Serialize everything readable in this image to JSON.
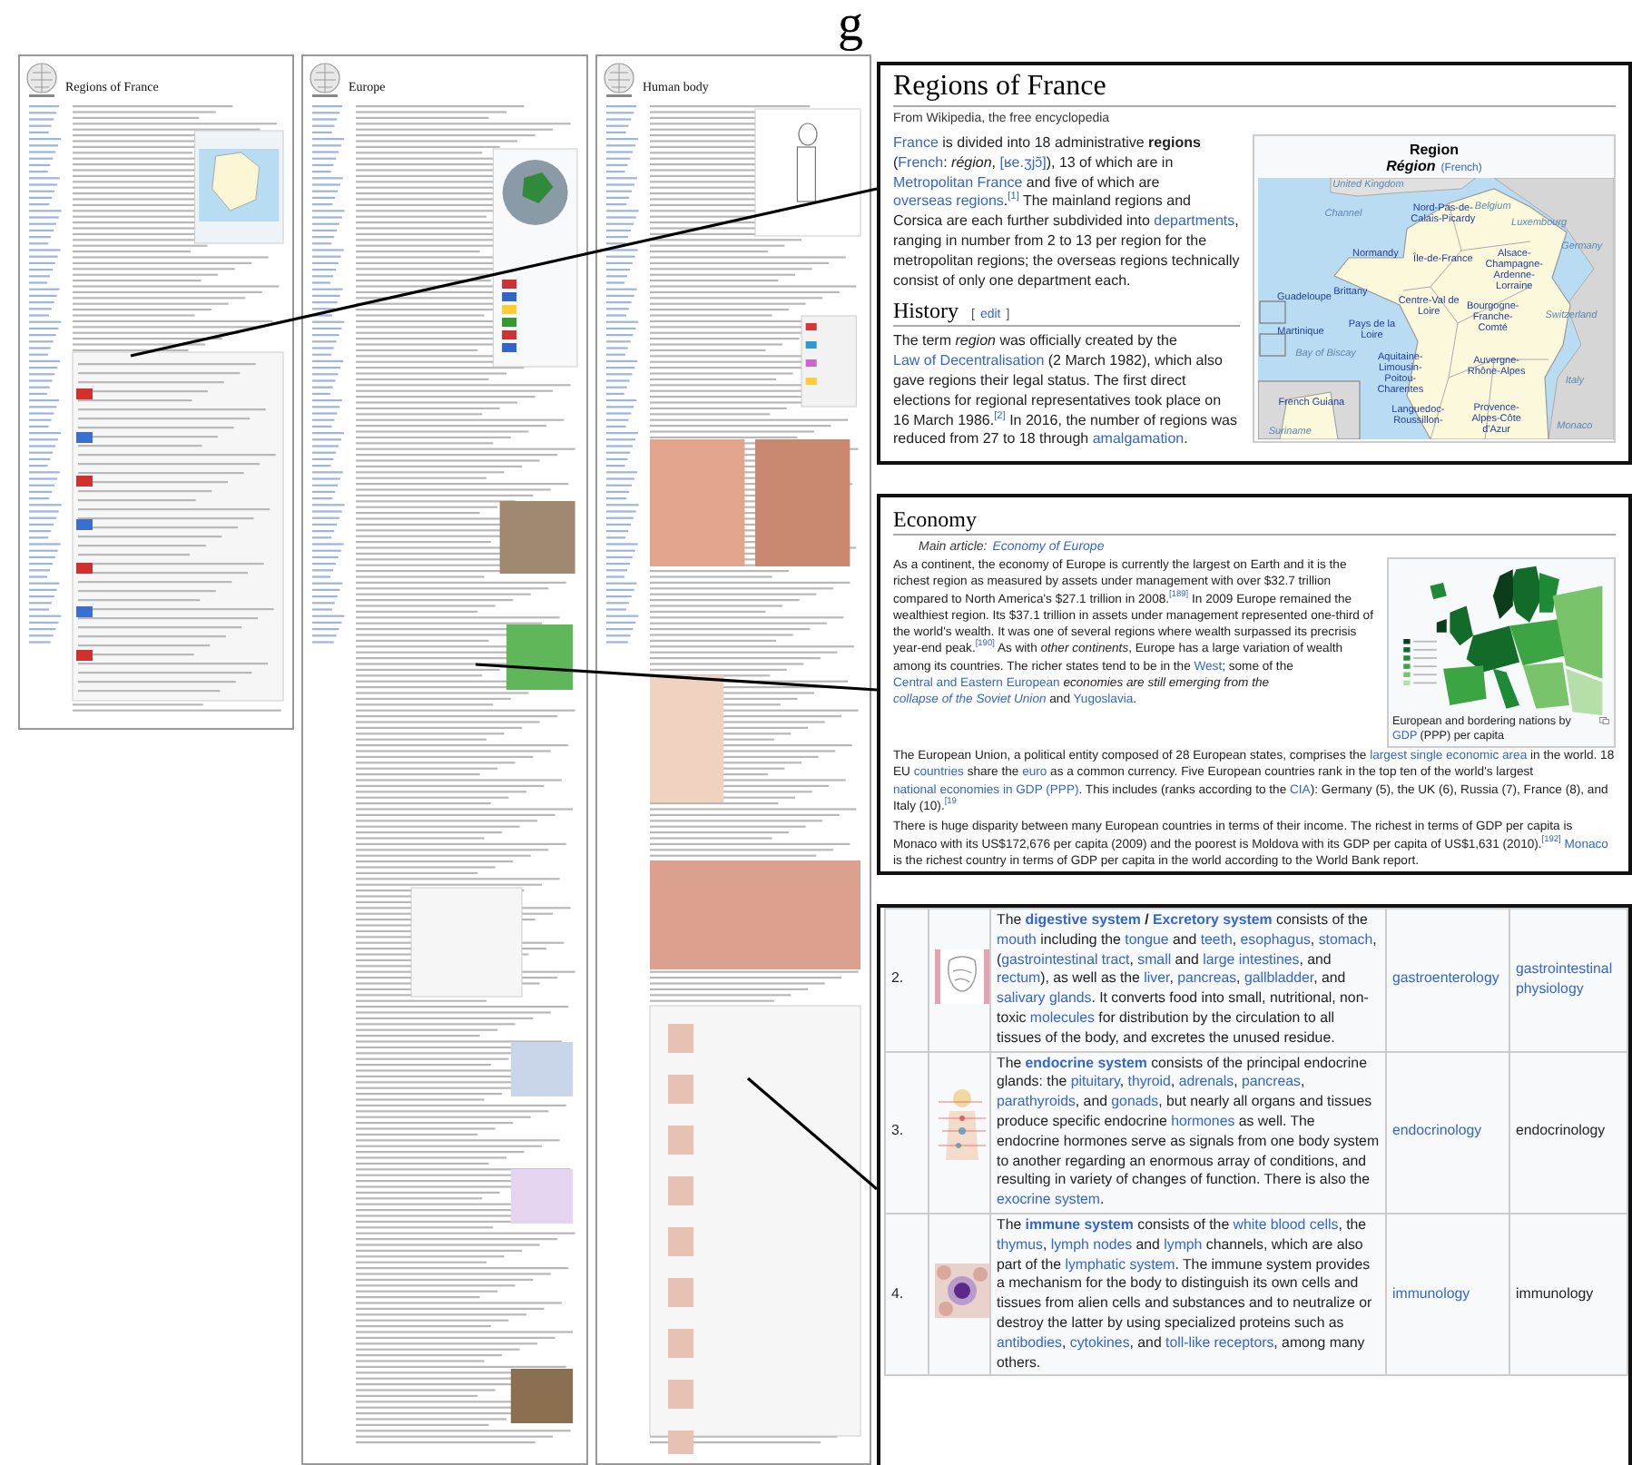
{
  "figure_label": "g",
  "thumbnails": [
    {
      "title": "Regions of France",
      "kind": "france"
    },
    {
      "title": "Europe",
      "kind": "europe"
    },
    {
      "title": "Human body",
      "kind": "body"
    }
  ],
  "france": {
    "title": "Regions of France",
    "tagline": "From Wikipedia, the free encyclopedia",
    "intro": [
      {
        "link": "France"
      },
      " is divided into 18 administrative **regions** (",
      {
        "link": "French"
      },
      ": *région*, ",
      {
        "link": "[ʁe.ʒjɔ̃]"
      },
      "), 13 of which are in ",
      {
        "link": "Metropolitan France"
      },
      " and five of which are ",
      {
        "link": "overseas regions"
      },
      ".",
      {
        "ref": "[1]"
      },
      "The mainland regions and Corsica are each further subdivided into ",
      {
        "link": "departments"
      },
      ", ranging in number from 2 to 13 per region for the metropolitan regions; the overseas regions technically consist of only one department each."
    ],
    "history_heading": "History",
    "edit_brackets": [
      "[",
      "]"
    ],
    "edit_label": "edit",
    "history": [
      "The term *region* was officially created by the ",
      {
        "link": "Law of Decentralisation"
      },
      " (2 March 1982), which also gave regions their legal status. The first direct elections for regional representatives took place on 16 March 1986.",
      {
        "ref": "[2]"
      },
      "In 2016, the number of regions was reduced from 27 to 18 through ",
      {
        "link": "amalgamation"
      },
      "."
    ],
    "map": {
      "title": "Region",
      "subtitle": "Région",
      "language": "(French)",
      "labels": [
        {
          "text": "United Kingdom",
          "kind": "place"
        },
        {
          "text": "Belgium",
          "kind": "place"
        },
        {
          "text": "Channel",
          "kind": "place"
        },
        {
          "text": "Nord-Pas-de-Calais-Picardy",
          "kind": "region"
        },
        {
          "text": "Luxembourg",
          "kind": "place"
        },
        {
          "text": "Germany",
          "kind": "place"
        },
        {
          "text": "Normandy",
          "kind": "region"
        },
        {
          "text": "Île-de-France",
          "kind": "region"
        },
        {
          "text": "Alsace-Champagne-Ardenne-Lorraine",
          "kind": "region"
        },
        {
          "text": "Guadeloupe",
          "kind": "region"
        },
        {
          "text": "Brittany",
          "kind": "region"
        },
        {
          "text": "Centre-Val de Loire",
          "kind": "region"
        },
        {
          "text": "Bourgogne-Franche-Comté",
          "kind": "region"
        },
        {
          "text": "Switzerland",
          "kind": "place"
        },
        {
          "text": "Martinique",
          "kind": "region"
        },
        {
          "text": "Pays de la Loire",
          "kind": "region"
        },
        {
          "text": "Bay of Biscay",
          "kind": "place"
        },
        {
          "text": "Aquitaine-Limousin-Poitou-Charentes",
          "kind": "region"
        },
        {
          "text": "Auvergne-Rhône-Alpes",
          "kind": "region"
        },
        {
          "text": "Italy",
          "kind": "place"
        },
        {
          "text": "French Guiana",
          "kind": "region"
        },
        {
          "text": "Languedoc-Roussillon-",
          "kind": "region"
        },
        {
          "text": "Provence-Alpes-Côte d'Azur",
          "kind": "region"
        },
        {
          "text": "Monaco",
          "kind": "place"
        },
        {
          "text": "Suriname",
          "kind": "place"
        }
      ]
    }
  },
  "economy": {
    "heading": "Economy",
    "main_prefix": "Main article:",
    "main_link": "Economy of Europe",
    "paragraphs": [
      [
        "As a continent, the economy of Europe is currently the largest on Earth and it is the richest region as measured by assets under management with over $32.7 trillion compared to North America's $27.1 trillion in 2008.",
        {
          "ref": "[189]"
        },
        "In 2009 Europe remained the wealthiest region. Its $37.1 trillion in assets under management represented one-third of the world's wealth. It was one of several regions where wealth surpassed its precrisis year-end peak.",
        {
          "ref": "[190]"
        },
        "As with *other continents*, Europe has a large variation of wealth among its countries. The richer states tend to be in the ",
        {
          "link": "West"
        },
        "; some of the ",
        {
          "link": "Central and Eastern European"
        },
        " *economies are still emerging from the* ",
        {
          "link": "collapse of the Soviet Union",
          "italic": true
        },
        " and ",
        {
          "link": "Yugoslavia"
        },
        "."
      ],
      [
        "The European Union, a political entity composed of 28 European states, comprises the ",
        {
          "link": "largest single economic area"
        },
        " in the world. 18 EU ",
        {
          "link": "countries"
        },
        " share the ",
        {
          "link": "euro"
        },
        " as a common currency. Five European countries rank in the top ten of the world's largest ",
        {
          "link": "national economies in GDP (PPP)"
        },
        ". This includes (ranks according to the ",
        {
          "link": "CIA"
        },
        "): Germany (5), the UK (6), Russia (7), France (8), and Italy (10).",
        {
          "ref": "[19"
        }
      ],
      [
        "There is huge disparity between many European countries in terms of their income. The richest in terms of GDP per capita is Monaco with its US$172,676 per capita (2009) and the poorest is Moldova with its GDP per capita of US$1,631 (2010).",
        {
          "ref": "[192]"
        },
        {
          "link": "Monaco"
        },
        " is the richest country in terms of GDP per capita in the world according to the World Bank report."
      ]
    ],
    "caption": [
      "European and bordering nations by ",
      {
        "link": "GDP"
      },
      " (PPP) per capita"
    ]
  },
  "body_table": {
    "rows": [
      {
        "number": "2.",
        "description": [
          "The ",
          {
            "link": "digestive system",
            "bold": true
          },
          " **/** ",
          {
            "link": "Excretory system",
            "bold": true
          },
          " consists of the ",
          {
            "link": "mouth"
          },
          " including the ",
          {
            "link": "tongue"
          },
          " and ",
          {
            "link": "teeth"
          },
          ", ",
          {
            "link": "esophagus"
          },
          ", ",
          {
            "link": "stomach"
          },
          ", (",
          {
            "link": "gastrointestinal tract"
          },
          ", ",
          {
            "link": "small"
          },
          " and ",
          {
            "link": "large intestines"
          },
          ", and ",
          {
            "link": "rectum"
          },
          "), as well as the ",
          {
            "link": "liver"
          },
          ", ",
          {
            "link": "pancreas"
          },
          ", ",
          {
            "link": "gallbladder"
          },
          ", and ",
          {
            "link": "salivary glands"
          },
          ". It converts food into small, nutritional, non-toxic ",
          {
            "link": "molecules"
          },
          " for distribution by the circulation to all tissues of the body, and excretes the unused residue."
        ],
        "field": {
          "text": "gastroenterology",
          "link": true
        },
        "study": {
          "text": "gastrointestinal physiology",
          "link": true
        }
      },
      {
        "number": "3.",
        "description": [
          "The ",
          {
            "link": "endocrine system",
            "bold": true
          },
          " consists of the principal endocrine glands: the ",
          {
            "link": "pituitary"
          },
          ", ",
          {
            "link": "thyroid"
          },
          ", ",
          {
            "link": "adrenals"
          },
          ", ",
          {
            "link": "pancreas"
          },
          ", ",
          {
            "link": "parathyroids"
          },
          ", and ",
          {
            "link": "gonads"
          },
          ", but nearly all organs and tissues produce specific endocrine ",
          {
            "link": "hormones"
          },
          " as well. The endocrine hormones serve as signals from one body system to another regarding an enormous array of conditions, and resulting in variety of changes of function. There is also the ",
          {
            "link": "exocrine system"
          },
          "."
        ],
        "field": {
          "text": "endocrinology",
          "link": true
        },
        "study": {
          "text": "endocrinology",
          "link": false
        }
      },
      {
        "number": "4.",
        "description": [
          "The ",
          {
            "link": "immune system",
            "bold": true
          },
          " consists of the ",
          {
            "link": "white blood cells"
          },
          ", the ",
          {
            "link": "thymus"
          },
          ", ",
          {
            "link": "lymph nodes"
          },
          " and ",
          {
            "link": "lymph"
          },
          " channels, which are also part of the ",
          {
            "link": "lymphatic system"
          },
          ". The immune system provides a mechanism for the body to distinguish its own cells and tissues from alien cells and substances and to neutralize or destroy the latter by using specialized proteins such as ",
          {
            "link": "antibodies"
          },
          ", ",
          {
            "link": "cytokines"
          },
          ", and ",
          {
            "link": "toll-like receptors"
          },
          ", among many others."
        ],
        "field": {
          "text": "immunology",
          "link": true
        },
        "study": {
          "text": "immunology",
          "link": false
        }
      }
    ]
  }
}
